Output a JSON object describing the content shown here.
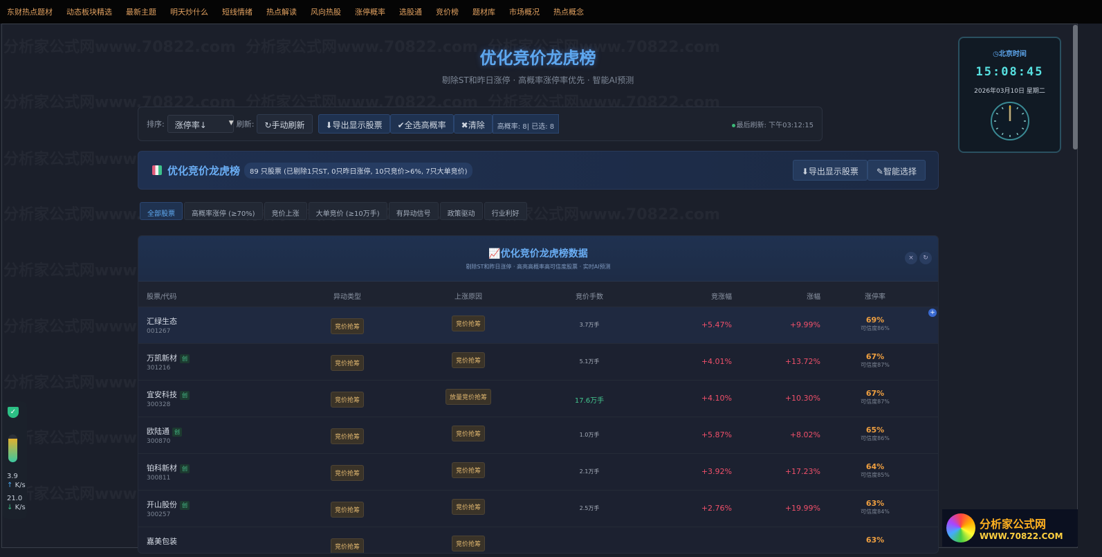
{
  "topnav": [
    "东财热点题材",
    "动态板块精选",
    "最新主题",
    "明天炒什么",
    "短线情绪",
    "热点解读",
    "风向热股",
    "涨停概率",
    "选股通",
    "竞价榜",
    "题材库",
    "市场概况",
    "热点概念"
  ],
  "watermark": "分析家公式网www.70822.com",
  "header": {
    "title": "优化竞价龙虎榜",
    "subtitle": "剔除ST和昨日涨停 · 高概率涨停率优先 · 智能AI预测"
  },
  "toolbar": {
    "sort_label": "排序:",
    "sort_value": "涨停率↓",
    "refresh_label": "刷新:",
    "manual_refresh": "手动刷新",
    "export": "导出显示股票",
    "select_high": "全选高概率",
    "clear": "清除",
    "stats": "高概率: 8| 已选: 8",
    "last_refresh": "最后刷新: 下午03:12:15"
  },
  "banner": {
    "title": "优化竞价龙虎榜",
    "summary": "89 只股票 (已剔除1只ST, 0只昨日涨停, 10只竞价>6%, 7只大单竞价)",
    "export": "导出显示股票",
    "smart": "智能选择"
  },
  "tabs": [
    "全部股票",
    "高概率涨停 (≥70%)",
    "竞价上涨",
    "大单竞价 (≥10万手)",
    "有异动信号",
    "政策驱动",
    "行业利好"
  ],
  "panel": {
    "title": "优化竞价龙虎榜数据",
    "subtitle": "剔除ST和昨日涨停 · 高亮高概率高可信度股票 · 实时AI预测",
    "close": "×",
    "refresh": "↻"
  },
  "columns": [
    "股票/代码",
    "异动类型",
    "上涨原因",
    "竞价手数",
    "竞涨幅",
    "涨幅",
    "涨停率"
  ],
  "rows": [
    {
      "name": "汇绿生态",
      "code": "001267",
      "tag": "",
      "type": "竞价抢筹",
      "reason": "竞价抢筹",
      "vol": "3.7万手",
      "auction": "+5.47%",
      "change": "+9.99%",
      "rate": "69%",
      "conf": "可信度86%"
    },
    {
      "name": "万凯新材",
      "code": "301216",
      "tag": "创",
      "type": "竞价抢筹",
      "reason": "竞价抢筹",
      "vol": "5.1万手",
      "auction": "+4.01%",
      "change": "+13.72%",
      "rate": "67%",
      "conf": "可信度87%"
    },
    {
      "name": "宜安科技",
      "code": "300328",
      "tag": "创",
      "type": "竞价抢筹",
      "reason": "放量竞价抢筹",
      "vol": "17.6万手",
      "auction": "+4.10%",
      "change": "+10.30%",
      "rate": "67%",
      "conf": "可信度87%"
    },
    {
      "name": "欧陆通",
      "code": "300870",
      "tag": "创",
      "type": "竞价抢筹",
      "reason": "竞价抢筹",
      "vol": "1.0万手",
      "auction": "+5.87%",
      "change": "+8.02%",
      "rate": "65%",
      "conf": "可信度86%"
    },
    {
      "name": "铂科新材",
      "code": "300811",
      "tag": "创",
      "type": "竞价抢筹",
      "reason": "竞价抢筹",
      "vol": "2.1万手",
      "auction": "+3.92%",
      "change": "+17.23%",
      "rate": "64%",
      "conf": "可信度85%"
    },
    {
      "name": "开山股份",
      "code": "300257",
      "tag": "创",
      "type": "竞价抢筹",
      "reason": "竞价抢筹",
      "vol": "2.5万手",
      "auction": "+2.76%",
      "change": "+19.99%",
      "rate": "63%",
      "conf": "可信度84%"
    },
    {
      "name": "嘉美包装",
      "code": "",
      "tag": "",
      "type": "竞价抢筹",
      "reason": "竞价抢筹",
      "vol": "",
      "auction": "",
      "change": "",
      "rate": "63%",
      "conf": ""
    }
  ],
  "clock": {
    "title": "北京时间",
    "time": "15:08:45",
    "date": "2026年03月10日 星期二"
  },
  "side": {
    "up": "3.9",
    "up_unit": "K/s",
    "down": "21.0",
    "down_unit": "K/s"
  },
  "logo": {
    "line1": "分析家公式网",
    "line2": "WWW.70822.COM"
  }
}
